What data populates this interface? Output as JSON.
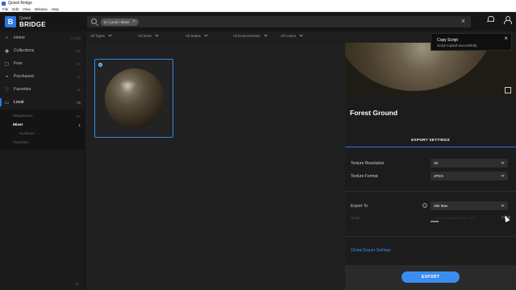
{
  "window": {
    "title": "Quixel Bridge"
  },
  "menu": [
    "File",
    "Edit",
    "View",
    "Window",
    "Help"
  ],
  "brand": {
    "line1": "Quixel",
    "line2": "BRIDGE"
  },
  "search": {
    "chip": "In: Local / Mixer",
    "clear": "×"
  },
  "sidebar": {
    "items": [
      {
        "label": "Home",
        "count": "11,818"
      },
      {
        "label": "Collections",
        "count": "105"
      },
      {
        "label": "Free",
        "count": "58"
      },
      {
        "label": "Purchased",
        "count": "31"
      },
      {
        "label": "Favorites",
        "count": "11"
      },
      {
        "label": "Local",
        "count": "58"
      }
    ],
    "sub": [
      {
        "label": "Megascans",
        "count": "57"
      },
      {
        "label": "Mixer",
        "count": "1"
      },
      {
        "label": "Surfaces",
        "count": ""
      },
      {
        "label": "Imported",
        "count": ""
      }
    ]
  },
  "filters": [
    "All Types",
    "All Sizes",
    "All States",
    "All Environments",
    "All Colors"
  ],
  "asset": {
    "title": "Forest Ground"
  },
  "export": {
    "tab": "EXPORT SETTINGS",
    "texture_resolution_label": "Texture Resolution",
    "texture_resolution_value": "2K",
    "texture_format_label": "Texture Format",
    "texture_format_value": "JPEG",
    "export_to_label": "Export To",
    "export_to_value": "3ds Max",
    "help": "?",
    "script_label": "Script",
    "script_value": "\\quixel_bridge\\3ds Max_2017",
    "copy": "Copy",
    "global_settings": "Global Export Settings",
    "button": "EXPORT"
  },
  "toast": {
    "title": "Copy Script",
    "message": "Script Copied Successfully",
    "close": "×"
  }
}
